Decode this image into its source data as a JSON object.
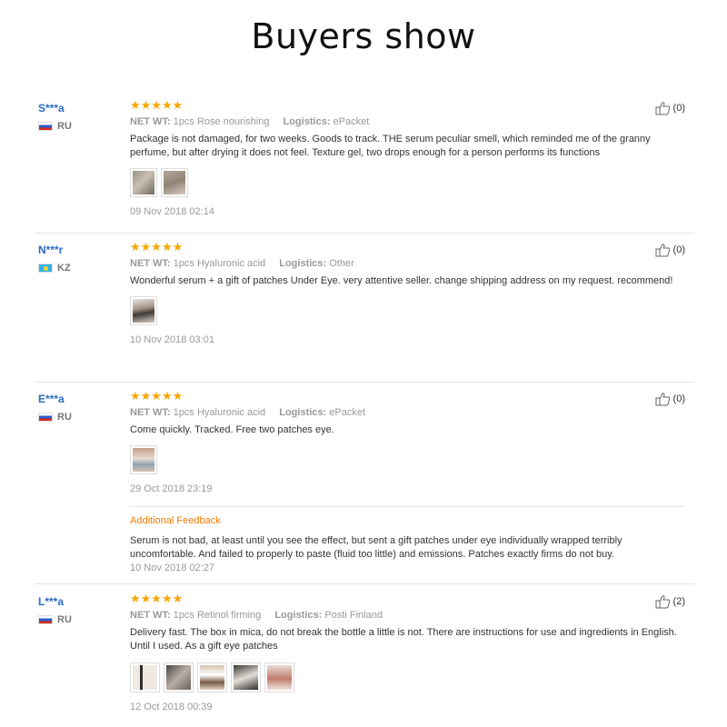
{
  "page_title": "Buyers show",
  "reviews": [
    {
      "user": "S***a",
      "country": "RU",
      "stars": "★★★★★",
      "net_wt_label": "NET WT:",
      "net_wt_value": "1pcs Rose nourishing",
      "logistics_label": "Logistics:",
      "logistics_value": "ePacket",
      "text": "Package is not damaged, for two weeks. Goods to track. THE serum peculiar smell, which reminded me of the granny perfume, but after drying it does not feel. Texture gel, two drops enough for a person performs its functions",
      "date": "09 Nov 2018 02:14",
      "likes": "(0)"
    },
    {
      "user": "N***r",
      "country": "KZ",
      "stars": "★★★★★",
      "net_wt_label": "NET WT:",
      "net_wt_value": "1pcs Hyaluronic acid",
      "logistics_label": "Logistics:",
      "logistics_value": "Other",
      "text": "Wonderful serum + a gift of patches Under Eye. very attentive seller. change shipping address on my request. recommend!",
      "date": "10 Nov 2018 03:01",
      "likes": "(0)"
    },
    {
      "user": "E***a",
      "country": "RU",
      "stars": "★★★★★",
      "net_wt_label": "NET WT:",
      "net_wt_value": "1pcs Hyaluronic acid",
      "logistics_label": "Logistics:",
      "logistics_value": "ePacket",
      "text": "Come quickly. Tracked. Free two patches eye.",
      "date": "29 Oct 2018 23:19",
      "likes": "(0)",
      "additional_title": "Additional Feedback",
      "additional_text": "Serum is not bad, at least until you see the effect, but sent a gift patches under eye individually wrapped terribly uncomfortable. And failed to properly to paste (fluid too little) and emissions. Patches exactly firms do not buy.",
      "additional_date": "10 Nov 2018 02:27"
    },
    {
      "user": "L***a",
      "country": "RU",
      "stars": "★★★★★",
      "net_wt_label": "NET WT:",
      "net_wt_value": "1pcs Retinol firming",
      "logistics_label": "Logistics:",
      "logistics_value": "Posti Finland",
      "text": "Delivery fast. The box in mica, do not break the bottle a little is not. There are instructions for use and ingredients in English. Until I used. As a gift eye patches",
      "date": "12 Oct 2018 00:39",
      "likes": "(2)"
    }
  ],
  "colors": {
    "username": "#2a6cc1",
    "stars": "#f7a600",
    "additional_feedback": "#f07c00",
    "muted": "#999999"
  },
  "icons": [
    "thumbs-up-icon",
    "star-icon",
    "flag-ru-icon",
    "flag-kz-icon"
  ]
}
